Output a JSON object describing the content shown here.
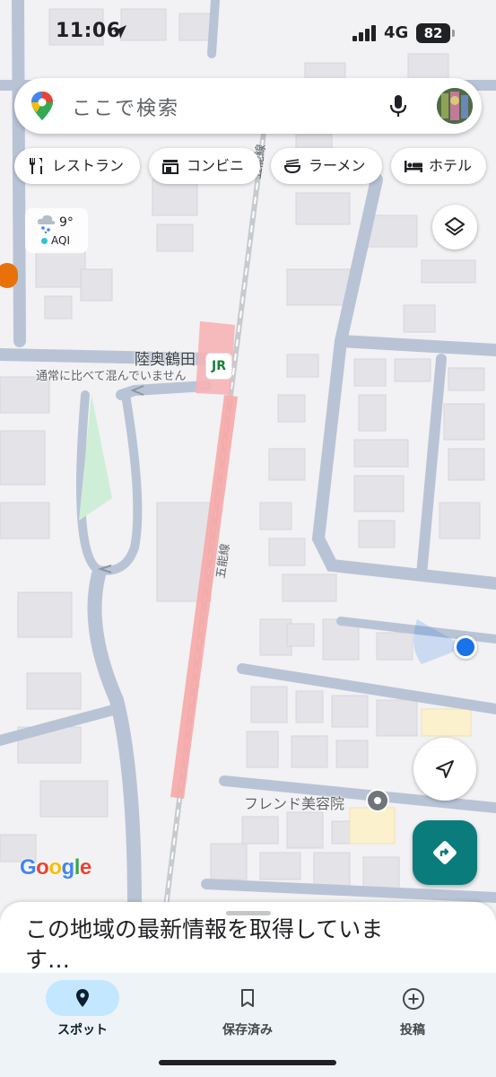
{
  "status_bar": {
    "time": "11:06",
    "network": "4G",
    "battery": "82"
  },
  "search": {
    "placeholder": "ここで検索"
  },
  "chips": [
    {
      "label": "レストラン",
      "icon": "restaurant-icon"
    },
    {
      "label": "コンビニ",
      "icon": "store-icon"
    },
    {
      "label": "ラーメン",
      "icon": "ramen-icon"
    },
    {
      "label": "ホテル",
      "icon": "hotel-icon"
    }
  ],
  "weather": {
    "temp": "9°",
    "aqi": "AQI"
  },
  "map": {
    "station_name": "陸奥鶴田",
    "station_note": "通常に比べて混んでいません",
    "station_badge": "JR",
    "rail_label": "五能線",
    "poi_label": "フレンド美容院",
    "watermark": "Google"
  },
  "sheet": {
    "message": "この地域の最新情報を取得しています…"
  },
  "nav": [
    {
      "label": "スポット",
      "icon": "explore-pin-icon",
      "active": true
    },
    {
      "label": "保存済み",
      "icon": "bookmark-icon",
      "active": false
    },
    {
      "label": "投稿",
      "icon": "add-circle-icon",
      "active": false
    }
  ],
  "colors": {
    "accent_teal": "#0b7c7c",
    "location_blue": "#1a73e8",
    "active_nav": "#c2e7ff",
    "station_pink": "#f6a9a9"
  }
}
